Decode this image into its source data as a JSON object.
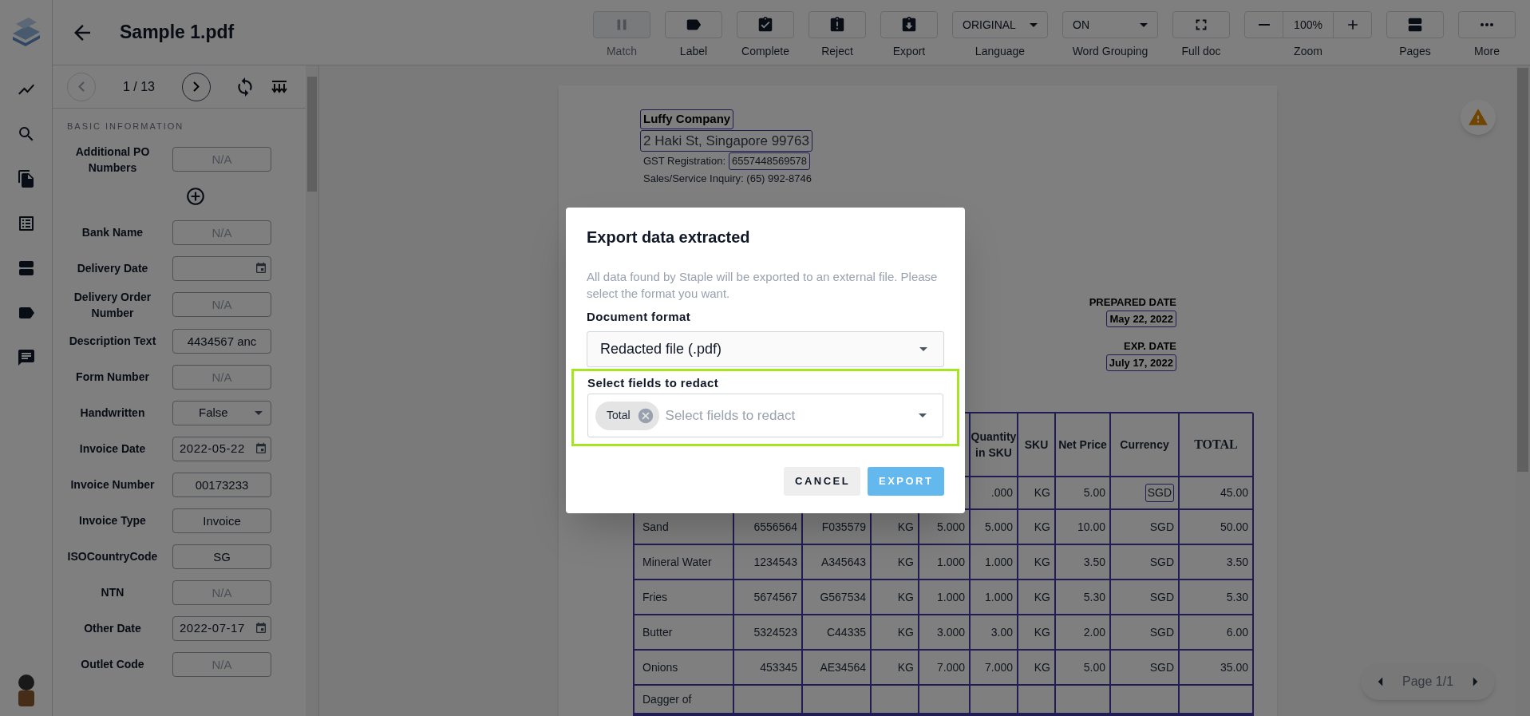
{
  "header": {
    "title": "Sample 1.pdf"
  },
  "toolbar": [
    {
      "label": "Match",
      "kind": "button",
      "disabled": true
    },
    {
      "label": "Label",
      "kind": "button",
      "disabled": false
    },
    {
      "label": "Complete",
      "kind": "button",
      "disabled": false
    },
    {
      "label": "Reject",
      "kind": "button",
      "disabled": false
    },
    {
      "label": "Export",
      "kind": "button",
      "disabled": false
    },
    {
      "label": "Language",
      "kind": "dropdown",
      "value": "ORIGINAL",
      "disabled": false
    },
    {
      "label": "Word Grouping",
      "kind": "dropdown",
      "value": "ON",
      "disabled": false
    },
    {
      "label": "Full doc",
      "kind": "button",
      "disabled": false
    },
    {
      "label": "Zoom",
      "kind": "zoom",
      "value": "100%",
      "disabled": false
    },
    {
      "label": "Pages",
      "kind": "button",
      "disabled": false
    },
    {
      "label": "More",
      "kind": "button",
      "disabled": false
    }
  ],
  "fields_panel": {
    "pager": {
      "text": "1 / 13",
      "prev_disabled": true
    },
    "section": "BASIC INFORMATION",
    "fields": [
      {
        "label": "Additional PO Numbers",
        "kind": "text",
        "placeholder": "N/A",
        "addable": true
      },
      {
        "label": "Bank Name",
        "kind": "text",
        "placeholder": "N/A",
        "addable": false
      },
      {
        "label": "Delivery Date",
        "kind": "date",
        "addable": false
      },
      {
        "label": "Delivery Order Number",
        "kind": "text",
        "placeholder": "N/A",
        "addable": false
      },
      {
        "label": "Description Text",
        "kind": "text",
        "value": "4434567 anc",
        "addable": false
      },
      {
        "label": "Form Number",
        "kind": "text",
        "placeholder": "N/A",
        "addable": false
      },
      {
        "label": "Handwritten",
        "kind": "select",
        "value": "False",
        "addable": false
      },
      {
        "label": "Invoice Date",
        "kind": "date",
        "value": "2022-05-22",
        "addable": false
      },
      {
        "label": "Invoice Number",
        "kind": "text",
        "value": "00173233",
        "addable": false
      },
      {
        "label": "Invoice Type",
        "kind": "text",
        "value": "Invoice",
        "addable": false
      },
      {
        "label": "ISOCountryCode",
        "kind": "text",
        "value": "SG",
        "addable": false
      },
      {
        "label": "NTN",
        "kind": "text",
        "placeholder": "N/A",
        "addable": false
      },
      {
        "label": "Other Date",
        "kind": "date",
        "value": "2022-07-17",
        "addable": false
      },
      {
        "label": "Outlet Code",
        "kind": "text",
        "placeholder": "N/A",
        "addable": false
      }
    ]
  },
  "document": {
    "header_lines": [
      [
        {
          "text": "Luffy Company",
          "kind": "name",
          "boxed": true
        }
      ],
      [
        {
          "text": "2 Haki St, Singapore 99763",
          "kind": "address",
          "boxed": true
        }
      ],
      [
        {
          "text": "GST Registration:",
          "kind": "small",
          "boxed": false
        },
        {
          "text": "6557448569578",
          "kind": "small",
          "boxed": true
        }
      ],
      [
        {
          "text": "Sales/Service Inquiry: (65) 992-8746",
          "kind": "small",
          "boxed": false
        }
      ]
    ],
    "dates": [
      {
        "label": "PREPARED DATE",
        "value": "May 22, 2022"
      },
      {
        "label": "EXP. DATE",
        "value": "July 17, 2022"
      }
    ],
    "table": {
      "rows": [
        {
          "kind": "header",
          "cells": [
            "Quantity in SKU",
            "SKU",
            "Net Price",
            "Currency",
            "TOTAL"
          ]
        },
        {
          "kind": "covered",
          "cells": [
            ".000",
            "KG",
            "5.00",
            {
              "text": "SGD",
              "boxed": true
            },
            "45.00"
          ]
        },
        {
          "kind": "item",
          "cells": [
            "Sand",
            "6556564",
            "F035579",
            "KG",
            "5.000",
            "5.000",
            "KG",
            "10.00",
            "SGD",
            "50.00"
          ]
        },
        {
          "kind": "item",
          "cells": [
            "Mineral Water",
            "1234543",
            "A345643",
            "KG",
            "1.000",
            "1.000",
            "KG",
            "3.50",
            "SGD",
            "3.50"
          ]
        },
        {
          "kind": "item",
          "cells": [
            "Fries",
            "5674567",
            "G567534",
            "KG",
            "1.000",
            "1.000",
            "KG",
            "5.30",
            "SGD",
            "5.30"
          ]
        },
        {
          "kind": "item",
          "cells": [
            "Butter",
            "5324523",
            "C44335",
            "KG",
            "3.000",
            "3.00",
            "KG",
            "2.00",
            "SGD",
            "6.00"
          ]
        },
        {
          "kind": "item",
          "cells": [
            "Onions",
            "453345",
            "AE34564",
            "KG",
            "7.000",
            "7.000",
            "KG",
            "5.00",
            "SGD",
            "35.00"
          ]
        },
        {
          "kind": "cut",
          "cells": [
            "Dagger of"
          ]
        }
      ]
    }
  },
  "page_nav": {
    "text": "Page 1/1"
  },
  "dialog": {
    "title": "Export data extracted",
    "description": "All data found by Staple will be exported to an external file. Please select the format you want.",
    "format_label": "Document format",
    "format_value": "Redacted file (.pdf)",
    "redact_label": "Select fields to redact",
    "redact_highlighted": true,
    "redact_chips": [
      "Total"
    ],
    "redact_placeholder": "Select fields to redact",
    "buttons": [
      {
        "label": "CANCEL",
        "kind": "secondary"
      },
      {
        "label": "EXPORT",
        "kind": "primary"
      }
    ]
  }
}
